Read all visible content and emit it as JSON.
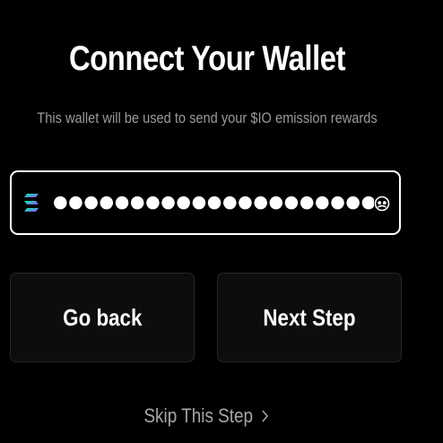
{
  "page": {
    "title": "Connect Your Wallet",
    "subtitle": "This wallet will be used to send your $IO emission rewards"
  },
  "wallet_input": {
    "value": "●●●●●●●●●●●●●●●●●●●●●●●●●●●●●●●●●●●●●●●●●●●●",
    "network_icon": "solana-icon",
    "reveal_icon": "eye-toggle-icon"
  },
  "buttons": {
    "back_label": "Go back",
    "next_label": "Next Step"
  },
  "skip": {
    "label": "Skip This Step",
    "icon": "chevron-right-icon"
  },
  "colors": {
    "background": "#000000",
    "text": "#ffffff",
    "muted_text": "#9a9a9a",
    "button_bg": "#0d0d0d",
    "button_border": "#262626",
    "solana_gradient": [
      "#00ffa3",
      "#9945ff"
    ]
  }
}
